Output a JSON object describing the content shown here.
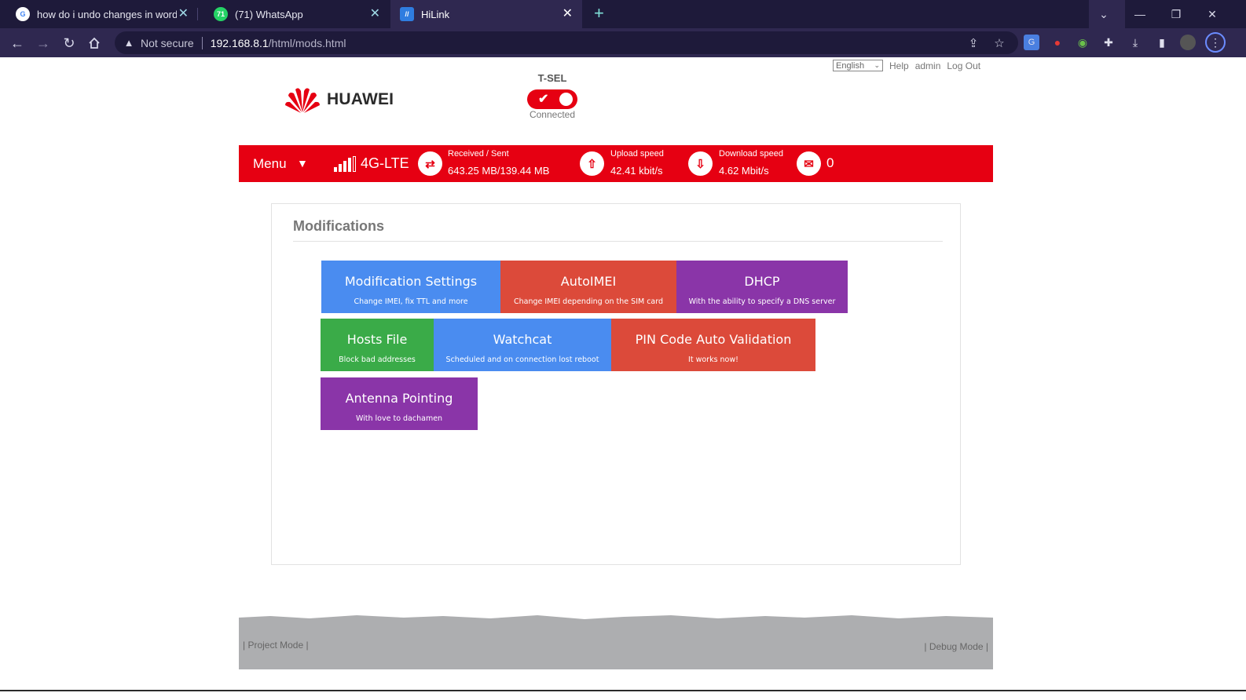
{
  "browser": {
    "tabs": [
      {
        "title": "how do i undo changes in word a",
        "icon": "google-icon"
      },
      {
        "title": "(71) WhatsApp",
        "icon": "whatsapp-icon"
      },
      {
        "title": "HiLink",
        "icon": "hilink-icon"
      }
    ],
    "security_label": "Not secure",
    "url_host": "192.168.8.1",
    "url_path": "/html/mods.html"
  },
  "header": {
    "language": "English",
    "help": "Help",
    "user": "admin",
    "logout": "Log Out",
    "brand": "HUAWEI",
    "operator": "T-SEL",
    "connection_status": "Connected"
  },
  "statusbar": {
    "menu": "Menu",
    "network_type": "4G-LTE",
    "received_sent_label": "Received / Sent",
    "received_sent_value": "643.25 MB/139.44 MB",
    "upload_label": "Upload speed",
    "upload_value": "42.41 kbit/s",
    "download_label": "Download speed",
    "download_value": "4.62 Mbit/s",
    "messages": "0",
    "colors": {
      "bar": "#e60012"
    }
  },
  "page": {
    "title": "Modifications",
    "tiles": [
      {
        "title": "Modification Settings",
        "subtitle": "Change IMEI, fix TTL and more",
        "color": "#4a8cf0"
      },
      {
        "title": "AutoIMEI",
        "subtitle": "Change IMEI depending on the SIM card",
        "color": "#dc4a3a"
      },
      {
        "title": "DHCP",
        "subtitle": "With the ability to specify a DNS server",
        "color": "#8a35a8"
      },
      {
        "title": "Hosts File",
        "subtitle": "Block bad addresses",
        "color": "#3aab48"
      },
      {
        "title": "Watchcat",
        "subtitle": "Scheduled and on connection lost reboot",
        "color": "#4a8cf0"
      },
      {
        "title": "PIN Code Auto Validation",
        "subtitle": "It works now!",
        "color": "#dc4a3a"
      },
      {
        "title": "Antenna Pointing",
        "subtitle": "With love to dachamen",
        "color": "#8a35a8"
      }
    ]
  },
  "footer": {
    "project_mode": "Project Mode",
    "debug_mode": "Debug Mode"
  }
}
